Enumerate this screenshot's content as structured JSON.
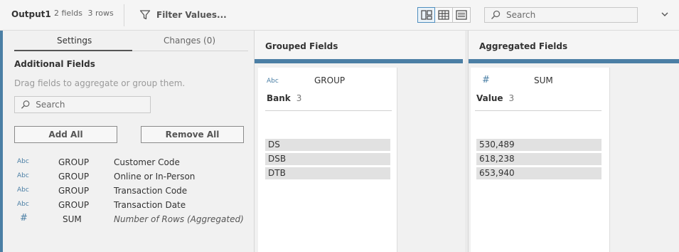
{
  "toolbar": {
    "title": "Output1",
    "fields_count": "2 fields",
    "rows_count": "3 rows",
    "filter_label": "Filter Values...",
    "search_placeholder": "Search"
  },
  "left_panel": {
    "tabs": [
      {
        "label": "Settings",
        "active": true
      },
      {
        "label": "Changes (0)",
        "active": false
      }
    ],
    "section_title": "Additional Fields",
    "hint": "Drag fields to aggregate or group them.",
    "search_placeholder": "Search",
    "add_all_label": "Add All",
    "remove_all_label": "Remove All",
    "fields": [
      {
        "type": "Abc",
        "role": "GROUP",
        "name": "Customer Code"
      },
      {
        "type": "Abc",
        "role": "GROUP",
        "name": "Online or In-Person"
      },
      {
        "type": "Abc",
        "role": "GROUP",
        "name": "Transaction Code"
      },
      {
        "type": "Abc",
        "role": "GROUP",
        "name": "Transaction Date"
      },
      {
        "type": "#",
        "role": "SUM",
        "name": "Number of Rows (Aggregated)"
      }
    ]
  },
  "grouped": {
    "title": "Grouped Fields",
    "type": "Abc",
    "role": "GROUP",
    "field": "Bank",
    "count": "3",
    "values": [
      "DS",
      "DSB",
      "DTB"
    ]
  },
  "aggregated": {
    "title": "Aggregated Fields",
    "type": "#",
    "role": "SUM",
    "field": "Value",
    "count": "3",
    "values": [
      "530,489",
      "618,238",
      "653,940"
    ]
  },
  "colors": {
    "accent": "#4b7fa5",
    "panel_bg": "#f1f1f1",
    "value_bg": "#e1e1e1"
  }
}
